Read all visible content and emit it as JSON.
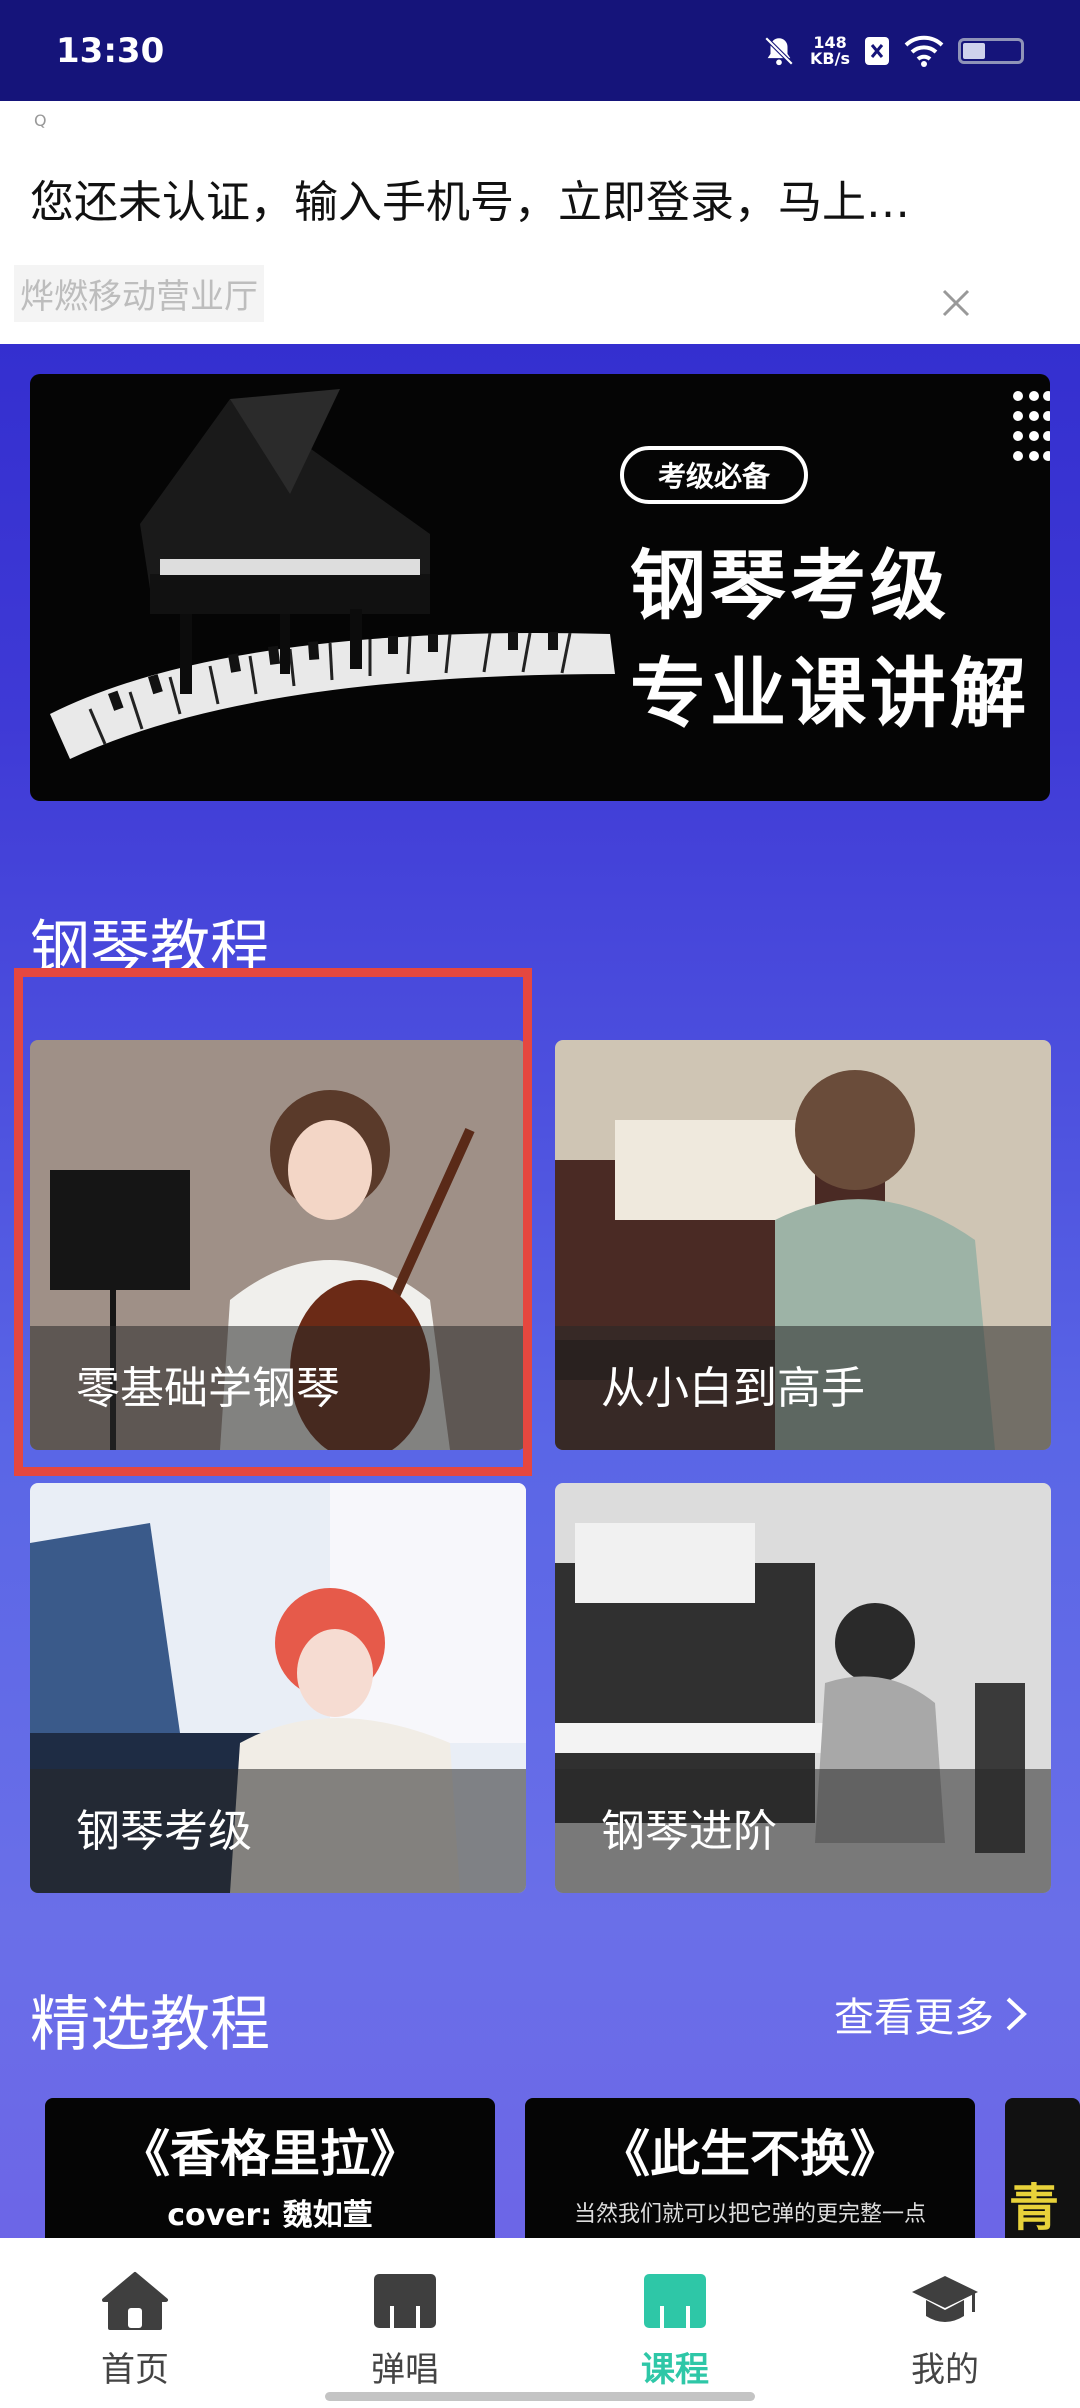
{
  "status_bar": {
    "time": "13:30",
    "net_speed_value": "148",
    "net_speed_unit": "KB/s"
  },
  "ad": {
    "mark": "Q",
    "text": "您还未认证，输入手机号，立即登录，马上…",
    "source": "烨燃移动营业厅"
  },
  "promo": {
    "tag": "考级必备",
    "line1": "钢琴考级",
    "line2": "专业课讲解"
  },
  "piano_section": {
    "title": "钢琴教程",
    "cards": [
      {
        "label": "零基础学钢琴"
      },
      {
        "label": "从小白到高手"
      },
      {
        "label": "钢琴考级"
      },
      {
        "label": "钢琴进阶"
      }
    ]
  },
  "featured_section": {
    "title": "精选教程",
    "see_more": "查看更多",
    "items": [
      {
        "title": "《香格里拉》",
        "subtitle": "cover: 魏如萱"
      },
      {
        "title": "《此生不换》",
        "subtitle": "当然我们就可以把它弹的更完整一点"
      },
      {
        "title": "青"
      }
    ]
  },
  "bottom_nav": {
    "items": [
      {
        "label": "首页",
        "icon": "home-icon"
      },
      {
        "label": "弹唱",
        "icon": "piano-keys-icon"
      },
      {
        "label": "课程",
        "icon": "course-keys-icon"
      },
      {
        "label": "我的",
        "icon": "graduation-cap-icon"
      }
    ],
    "active_index": 2,
    "active_color": "#2ec7a7"
  }
}
